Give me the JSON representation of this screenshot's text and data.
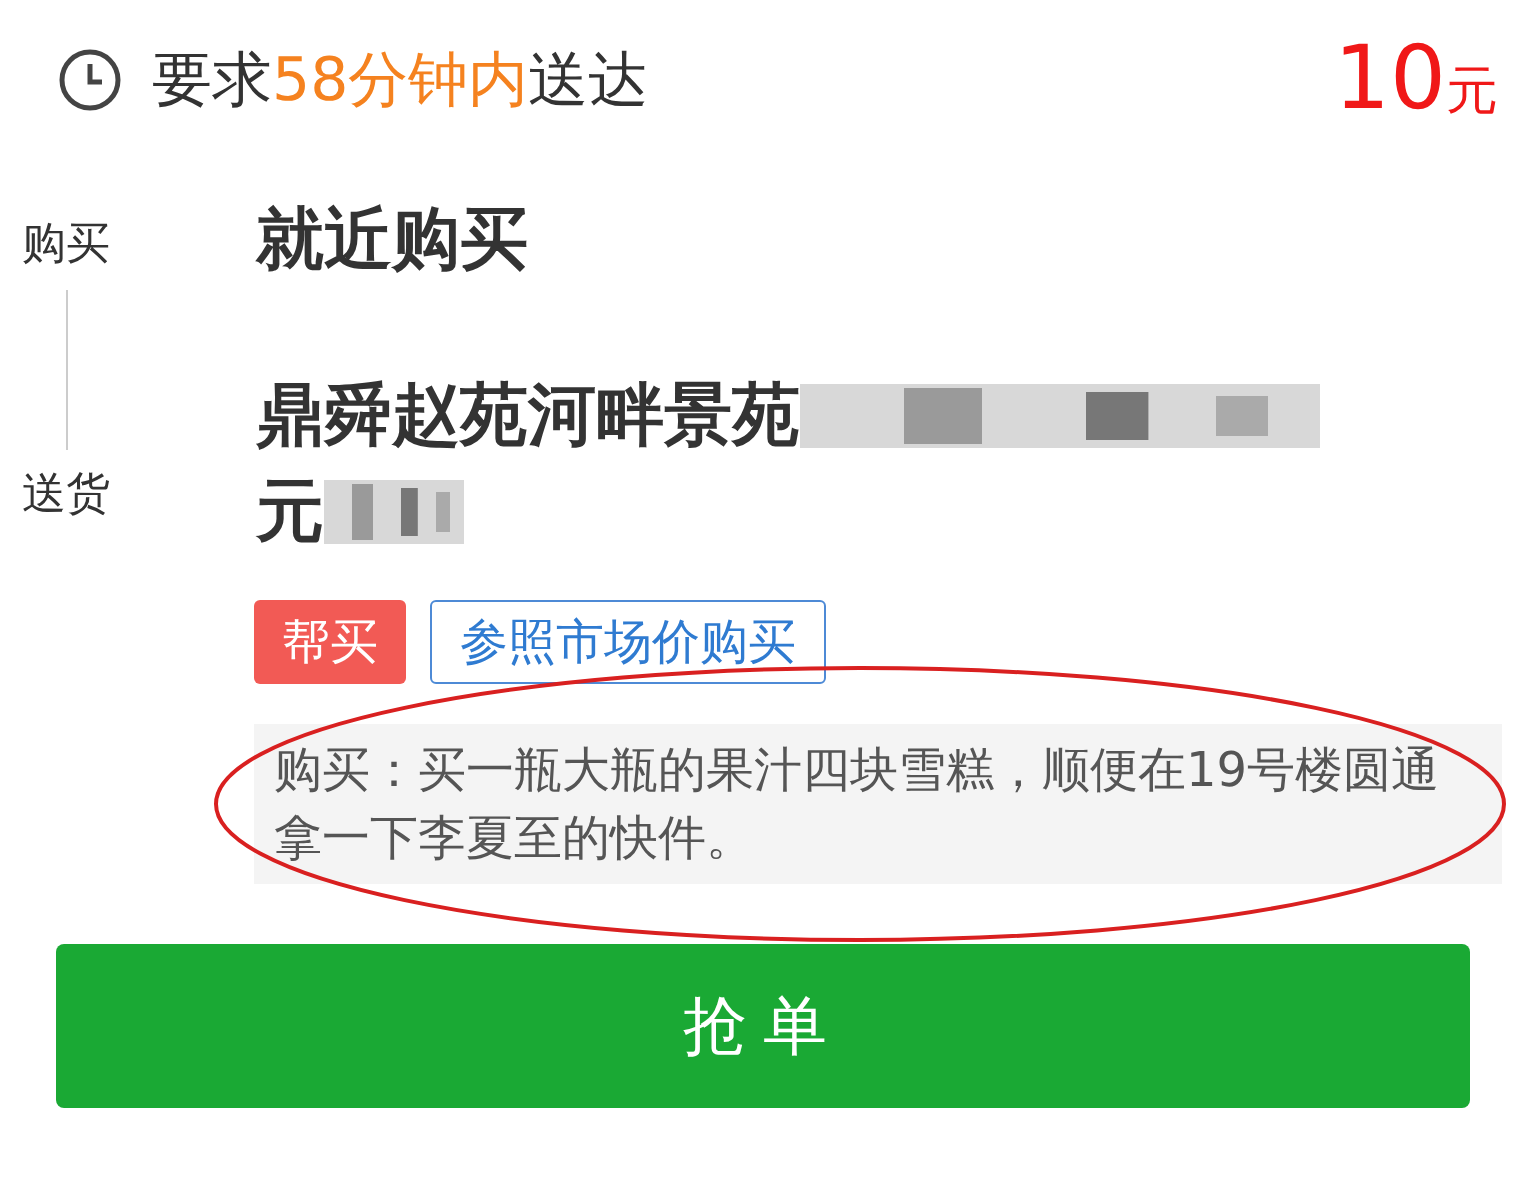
{
  "deadline": {
    "prefix": "要求",
    "highlight": "58分钟内",
    "suffix": "送达"
  },
  "price": {
    "amount": "10",
    "unit": "元"
  },
  "route": [
    {
      "label": "购买",
      "lines": [
        "就近购买"
      ],
      "redacted": false
    },
    {
      "label": "送货",
      "lines": [
        "鼎舜赵苑河畔景苑",
        "元"
      ],
      "redacted": true
    }
  ],
  "tags": [
    {
      "text": "帮买",
      "kind": "filled"
    },
    {
      "text": "参照市场价购买",
      "kind": "outline"
    }
  ],
  "note": {
    "text": "购买：买一瓶大瓶的果汁四块雪糕，顺便在19号楼圆通拿一下李夏至的快件。",
    "circled": true
  },
  "action_button": "抢单"
}
